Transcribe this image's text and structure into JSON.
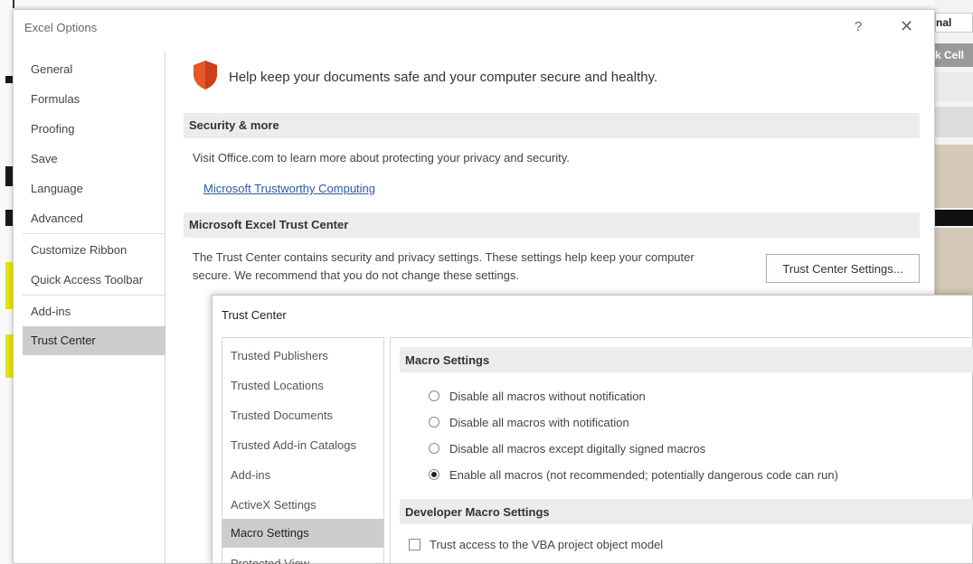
{
  "background": {
    "cell_text": "nal",
    "gray_text": "k Cell"
  },
  "options_dialog": {
    "title": "Excel Options",
    "help_glyph": "?",
    "close_glyph": "✕",
    "nav": [
      {
        "label": "General"
      },
      {
        "label": "Formulas"
      },
      {
        "label": "Proofing"
      },
      {
        "label": "Save"
      },
      {
        "label": "Language"
      },
      {
        "label": "Advanced"
      },
      {
        "label": "Customize Ribbon"
      },
      {
        "label": "Quick Access Toolbar"
      },
      {
        "label": "Add-ins"
      },
      {
        "label": "Trust Center",
        "selected": true
      }
    ],
    "header_text": "Help keep your documents safe and your computer secure and healthy.",
    "security_section": {
      "heading": "Security & more",
      "text": "Visit Office.com to learn more about protecting your privacy and security.",
      "link": "Microsoft Trustworthy Computing"
    },
    "trust_section": {
      "heading": "Microsoft Excel Trust Center",
      "text_line1": "The Trust Center contains security and privacy settings. These settings help keep your computer",
      "text_line2": "secure. We recommend that you do not change these settings.",
      "button": "Trust Center Settings..."
    }
  },
  "trust_center": {
    "title": "Trust Center",
    "nav": [
      {
        "label": "Trusted Publishers"
      },
      {
        "label": "Trusted Locations"
      },
      {
        "label": "Trusted Documents"
      },
      {
        "label": "Trusted Add-in Catalogs"
      },
      {
        "label": "Add-ins"
      },
      {
        "label": "ActiveX Settings"
      },
      {
        "label": "Macro Settings",
        "selected": true
      },
      {
        "label": "Protected View"
      }
    ],
    "macro_heading": "Macro Settings",
    "options": [
      {
        "label": "Disable all macros without notification",
        "checked": false
      },
      {
        "label": "Disable all macros with notification",
        "checked": false
      },
      {
        "label": "Disable all macros except digitally signed macros",
        "checked": false
      },
      {
        "label": "Enable all macros (not recommended; potentially dangerous code can run)",
        "checked": true
      }
    ],
    "dev_heading": "Developer Macro Settings",
    "vba_checkbox": {
      "label": "Trust access to the VBA project object model",
      "checked": false
    }
  },
  "colors": {
    "shield": "#e8562a",
    "link": "#2a5aa5",
    "selected_nav": "#cdcdcd",
    "section_band": "#ececec"
  }
}
